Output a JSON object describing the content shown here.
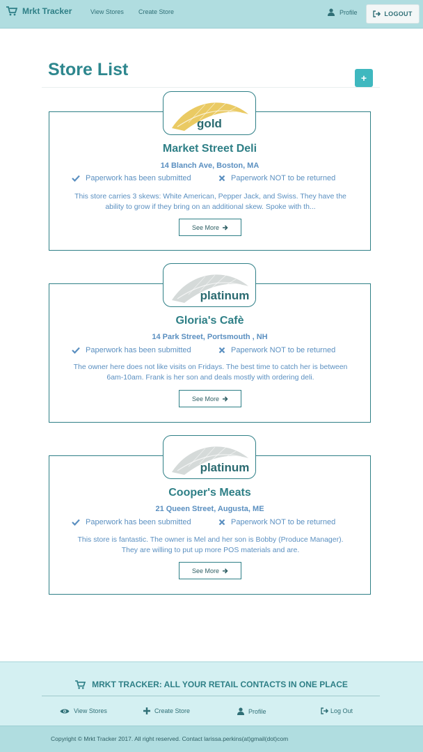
{
  "navbar": {
    "brand": "Mrkt Tracker",
    "links": [
      "View Stores",
      "Create Store"
    ],
    "profile_label": "Profile",
    "logout_label": "LOGOUT"
  },
  "page": {
    "title": "Store List",
    "add_label": "+"
  },
  "stores": [
    {
      "tier": "gold",
      "tier_color": "#e8c452",
      "name": "Market Street Deli",
      "address": "14 Blanch Ave, Boston, MA",
      "paperwork_submitted": "Paperwork has been submitted",
      "paperwork_return": "Paperwork NOT to be returned",
      "description": "This store carries 3 skews: White American, Pepper Jack, and Swiss. They have the ability to grow if they bring on an additional skew. Spoke with th...",
      "see_more": "See More"
    },
    {
      "tier": "platinum",
      "tier_color": "#cfd4d3",
      "name": "Gloria's Cafè",
      "address": "14 Park Street, Portsmouth , NH",
      "paperwork_submitted": "Paperwork has been submitted",
      "paperwork_return": "Paperwork NOT to be returned",
      "description": "The owner here does not like visits on Fridays. The best time to catch her is between 6am-10am. Frank is her son and deals mostly with ordering deli.",
      "see_more": "See More"
    },
    {
      "tier": "platinum",
      "tier_color": "#cfd4d3",
      "name": "Cooper's Meats",
      "address": "21 Queen Street, Augusta, ME",
      "paperwork_submitted": "Paperwork has been submitted",
      "paperwork_return": "Paperwork NOT to be returned",
      "description": "This store is fantastic. The owner is Mel and her son is Bobby (Produce Manager). They are willing to put up more POS materials and are.",
      "see_more": "See More"
    }
  ],
  "footer": {
    "title": "MRKT TRACKER: ALL YOUR RETAIL CONTACTS IN ONE PLACE",
    "links": [
      "View Stores",
      "Create Store",
      "Profile",
      "Log Out"
    ],
    "copyright": "Copyright © Mrkt Tracker 2017. All right reserved. Contact larissa.perkins(at)gmail(dot)com"
  },
  "colors": {
    "accent": "#2e7f86",
    "navbar_bg": "#b0dde0",
    "footer_bg": "#d4f0f2",
    "text_blue": "#5a8fc0"
  },
  "icons": {
    "brand": "cart-icon",
    "profile": "user-icon",
    "logout": "sign-out-icon",
    "submitted": "check-icon",
    "not_returned": "x-icon",
    "see_more": "arrow-right-icon",
    "footer_view": "eye-icon",
    "footer_create": "plus-icon",
    "footer_profile": "user-icon",
    "footer_logout": "sign-out-icon"
  }
}
